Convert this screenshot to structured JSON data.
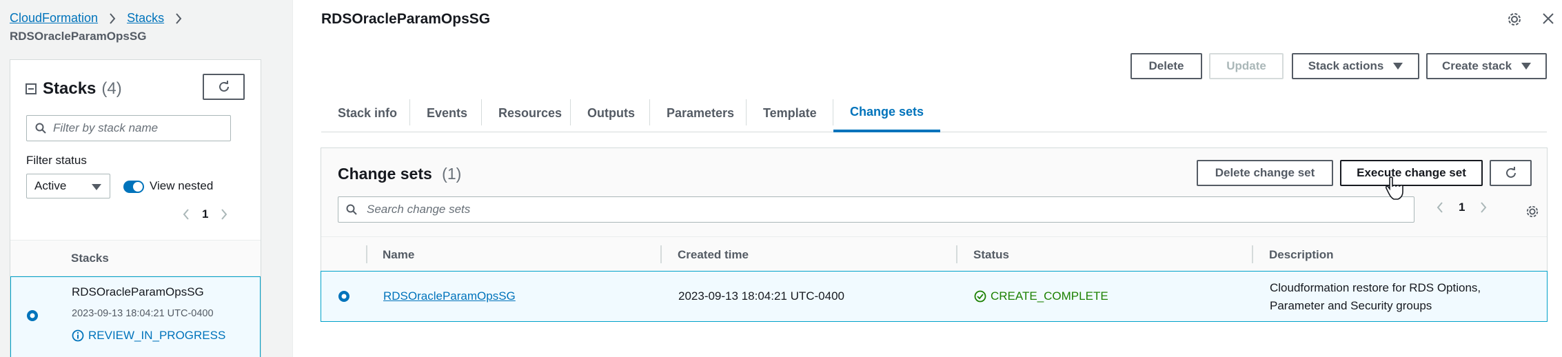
{
  "breadcrumb": {
    "items": [
      "CloudFormation",
      "Stacks"
    ],
    "current": "RDSOracleParamOpsSG"
  },
  "stacks_panel": {
    "title": "Stacks",
    "count": "(4)",
    "filter_placeholder": "Filter by stack name",
    "filter_status_label": "Filter status",
    "filter_status_value": "Active",
    "view_nested_label": "View nested",
    "page": "1",
    "column_header": "Stacks",
    "rows": [
      {
        "name": "RDSOracleParamOpsSG",
        "time": "2023-09-13 18:04:21 UTC-0400",
        "status": "REVIEW_IN_PROGRESS"
      }
    ]
  },
  "main": {
    "title": "RDSOracleParamOpsSG",
    "actions": {
      "delete": "Delete",
      "update": "Update",
      "stack_actions": "Stack actions",
      "create_stack": "Create stack"
    },
    "tabs": [
      "Stack info",
      "Events",
      "Resources",
      "Outputs",
      "Parameters",
      "Template",
      "Change sets"
    ],
    "active_tab": "Change sets"
  },
  "change_sets": {
    "title": "Change sets",
    "count": "(1)",
    "delete_label": "Delete change set",
    "execute_label": "Execute change set",
    "search_placeholder": "Search change sets",
    "page": "1",
    "columns": [
      "Name",
      "Created time",
      "Status",
      "Description"
    ],
    "rows": [
      {
        "name": "RDSOracleParamOpsSG",
        "created": "2023-09-13 18:04:21 UTC-0400",
        "status": "CREATE_COMPLETE",
        "description_line1": "Cloudformation restore for RDS Options,",
        "description_line2": "Parameter and Security groups"
      }
    ]
  },
  "colors": {
    "link": "#0073bb",
    "success": "#1d8102",
    "selected_row": "#f1faff"
  }
}
